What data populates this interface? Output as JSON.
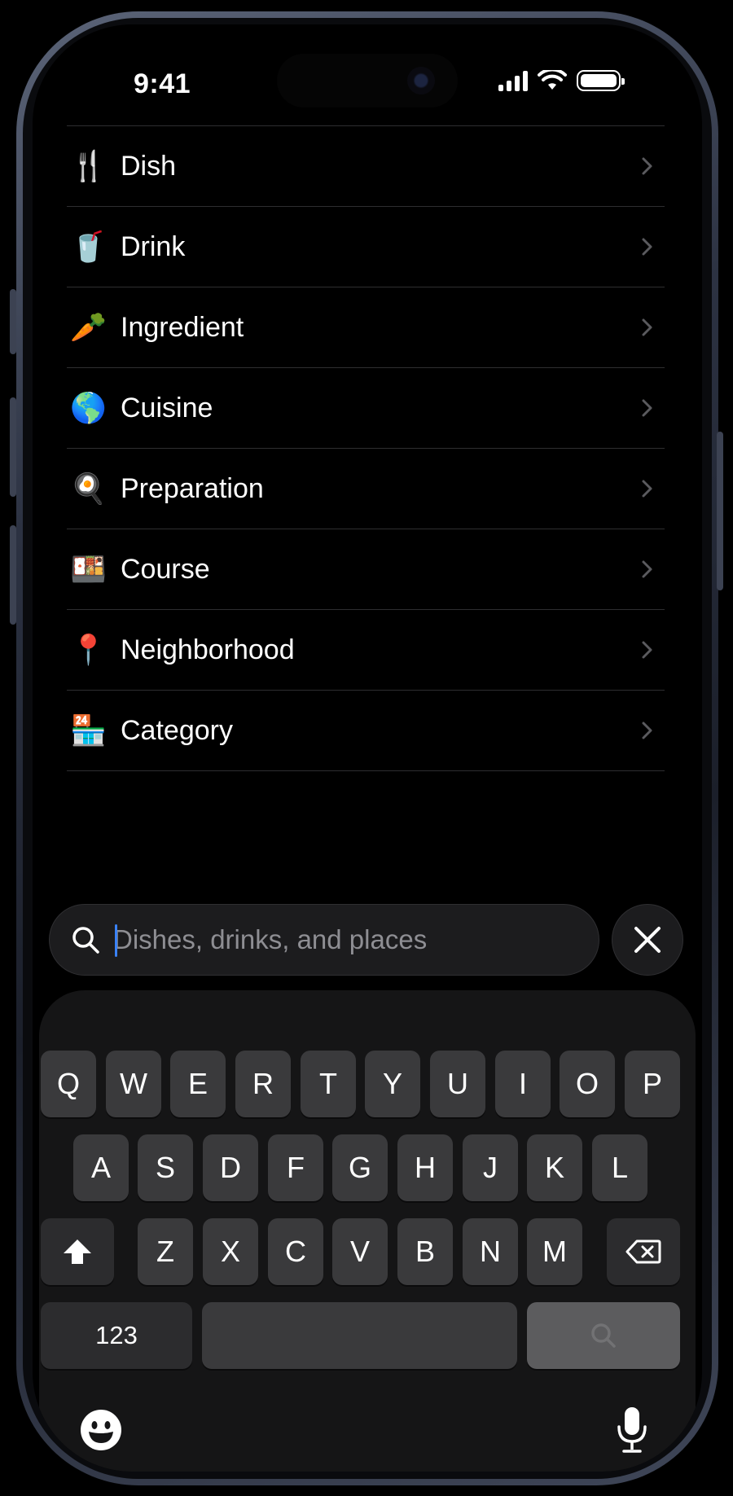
{
  "status": {
    "time": "9:41"
  },
  "list": {
    "items": [
      {
        "emoji": "🍴",
        "label": "Dish"
      },
      {
        "emoji": "🥤",
        "label": "Drink"
      },
      {
        "emoji": "🥕",
        "label": "Ingredient"
      },
      {
        "emoji": "🌎",
        "label": "Cuisine"
      },
      {
        "emoji": "🍳",
        "label": "Preparation"
      },
      {
        "emoji": "🍱",
        "label": "Course"
      },
      {
        "emoji": "📍",
        "label": "Neighborhood"
      },
      {
        "emoji": "🏪",
        "label": "Category"
      }
    ]
  },
  "search": {
    "placeholder": "Dishes, drinks, and places",
    "value": ""
  },
  "keyboard": {
    "row1": [
      "Q",
      "W",
      "E",
      "R",
      "T",
      "Y",
      "U",
      "I",
      "O",
      "P"
    ],
    "row2": [
      "A",
      "S",
      "D",
      "F",
      "G",
      "H",
      "J",
      "K",
      "L"
    ],
    "row3": [
      "Z",
      "X",
      "C",
      "V",
      "B",
      "N",
      "M"
    ],
    "numbers_label": "123"
  }
}
